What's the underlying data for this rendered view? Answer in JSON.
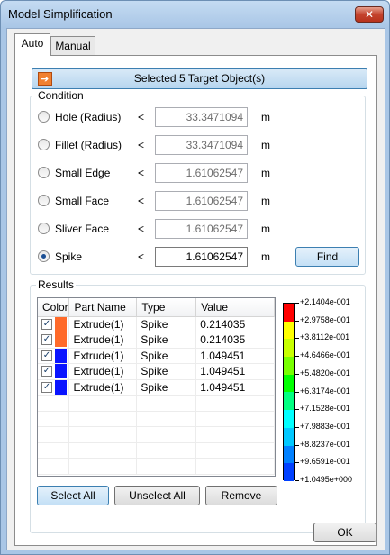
{
  "window": {
    "title": "Model Simplification",
    "close_label": "✕"
  },
  "tabs": [
    {
      "label": "Auto"
    },
    {
      "label": "Manual"
    }
  ],
  "target_button": {
    "label": "Selected 5 Target Object(s)",
    "icon": "arrow-import-icon"
  },
  "condition": {
    "legend": "Condition",
    "rows": [
      {
        "label": "Hole (Radius)",
        "op": "<",
        "value": "33.3471094",
        "unit": "m",
        "checked": false
      },
      {
        "label": "Fillet (Radius)",
        "op": "<",
        "value": "33.3471094",
        "unit": "m",
        "checked": false
      },
      {
        "label": "Small Edge",
        "op": "<",
        "value": "1.61062547",
        "unit": "m",
        "checked": false
      },
      {
        "label": "Small Face",
        "op": "<",
        "value": "1.61062547",
        "unit": "m",
        "checked": false
      },
      {
        "label": "Sliver Face",
        "op": "<",
        "value": "1.61062547",
        "unit": "m",
        "checked": false
      },
      {
        "label": "Spike",
        "op": "<",
        "value": "1.61062547",
        "unit": "m",
        "checked": true
      }
    ],
    "find_label": "Find"
  },
  "results": {
    "legend": "Results",
    "columns": [
      "Color",
      "Part Name",
      "Type",
      "Value"
    ],
    "rows": [
      {
        "color": "#ff6a2a",
        "checked": true,
        "part": "Extrude(1)",
        "type": "Spike",
        "value": "0.214035"
      },
      {
        "color": "#ff6a2a",
        "checked": true,
        "part": "Extrude(1)",
        "type": "Spike",
        "value": "0.214035"
      },
      {
        "color": "#0a14ff",
        "checked": true,
        "part": "Extrude(1)",
        "type": "Spike",
        "value": "1.049451"
      },
      {
        "color": "#0a14ff",
        "checked": true,
        "part": "Extrude(1)",
        "type": "Spike",
        "value": "1.049451"
      },
      {
        "color": "#0a14ff",
        "checked": true,
        "part": "Extrude(1)",
        "type": "Spike",
        "value": "1.049451"
      }
    ],
    "select_all_label": "Select All",
    "unselect_all_label": "Unselect All",
    "remove_label": "Remove"
  },
  "color_legend": {
    "colors": [
      "#ff0000",
      "#ffff00",
      "#c8ff00",
      "#78ff00",
      "#00ff00",
      "#00ff80",
      "#00ffff",
      "#00c8ff",
      "#0080ff",
      "#0040ff",
      "#0000ff"
    ],
    "labels": [
      "+2.1404e-001",
      "+2.9758e-001",
      "+3.8112e-001",
      "+4.6466e-001",
      "+5.4820e-001",
      "+6.3174e-001",
      "+7.1528e-001",
      "+7.9883e-001",
      "+8.8237e-001",
      "+9.6591e-001",
      "+1.0495e+000"
    ]
  },
  "footer": {
    "ok_label": "OK"
  }
}
